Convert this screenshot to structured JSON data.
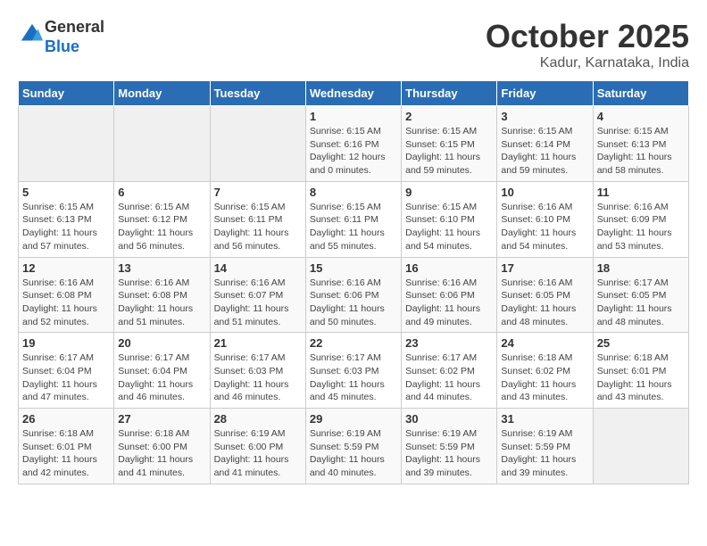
{
  "header": {
    "logo_line1": "General",
    "logo_line2": "Blue",
    "month": "October 2025",
    "location": "Kadur, Karnataka, India"
  },
  "weekdays": [
    "Sunday",
    "Monday",
    "Tuesday",
    "Wednesday",
    "Thursday",
    "Friday",
    "Saturday"
  ],
  "weeks": [
    [
      {
        "day": "",
        "info": ""
      },
      {
        "day": "",
        "info": ""
      },
      {
        "day": "",
        "info": ""
      },
      {
        "day": "1",
        "info": "Sunrise: 6:15 AM\nSunset: 6:16 PM\nDaylight: 12 hours and 0 minutes."
      },
      {
        "day": "2",
        "info": "Sunrise: 6:15 AM\nSunset: 6:15 PM\nDaylight: 11 hours and 59 minutes."
      },
      {
        "day": "3",
        "info": "Sunrise: 6:15 AM\nSunset: 6:14 PM\nDaylight: 11 hours and 59 minutes."
      },
      {
        "day": "4",
        "info": "Sunrise: 6:15 AM\nSunset: 6:13 PM\nDaylight: 11 hours and 58 minutes."
      }
    ],
    [
      {
        "day": "5",
        "info": "Sunrise: 6:15 AM\nSunset: 6:13 PM\nDaylight: 11 hours and 57 minutes."
      },
      {
        "day": "6",
        "info": "Sunrise: 6:15 AM\nSunset: 6:12 PM\nDaylight: 11 hours and 56 minutes."
      },
      {
        "day": "7",
        "info": "Sunrise: 6:15 AM\nSunset: 6:11 PM\nDaylight: 11 hours and 56 minutes."
      },
      {
        "day": "8",
        "info": "Sunrise: 6:15 AM\nSunset: 6:11 PM\nDaylight: 11 hours and 55 minutes."
      },
      {
        "day": "9",
        "info": "Sunrise: 6:15 AM\nSunset: 6:10 PM\nDaylight: 11 hours and 54 minutes."
      },
      {
        "day": "10",
        "info": "Sunrise: 6:16 AM\nSunset: 6:10 PM\nDaylight: 11 hours and 54 minutes."
      },
      {
        "day": "11",
        "info": "Sunrise: 6:16 AM\nSunset: 6:09 PM\nDaylight: 11 hours and 53 minutes."
      }
    ],
    [
      {
        "day": "12",
        "info": "Sunrise: 6:16 AM\nSunset: 6:08 PM\nDaylight: 11 hours and 52 minutes."
      },
      {
        "day": "13",
        "info": "Sunrise: 6:16 AM\nSunset: 6:08 PM\nDaylight: 11 hours and 51 minutes."
      },
      {
        "day": "14",
        "info": "Sunrise: 6:16 AM\nSunset: 6:07 PM\nDaylight: 11 hours and 51 minutes."
      },
      {
        "day": "15",
        "info": "Sunrise: 6:16 AM\nSunset: 6:06 PM\nDaylight: 11 hours and 50 minutes."
      },
      {
        "day": "16",
        "info": "Sunrise: 6:16 AM\nSunset: 6:06 PM\nDaylight: 11 hours and 49 minutes."
      },
      {
        "day": "17",
        "info": "Sunrise: 6:16 AM\nSunset: 6:05 PM\nDaylight: 11 hours and 48 minutes."
      },
      {
        "day": "18",
        "info": "Sunrise: 6:17 AM\nSunset: 6:05 PM\nDaylight: 11 hours and 48 minutes."
      }
    ],
    [
      {
        "day": "19",
        "info": "Sunrise: 6:17 AM\nSunset: 6:04 PM\nDaylight: 11 hours and 47 minutes."
      },
      {
        "day": "20",
        "info": "Sunrise: 6:17 AM\nSunset: 6:04 PM\nDaylight: 11 hours and 46 minutes."
      },
      {
        "day": "21",
        "info": "Sunrise: 6:17 AM\nSunset: 6:03 PM\nDaylight: 11 hours and 46 minutes."
      },
      {
        "day": "22",
        "info": "Sunrise: 6:17 AM\nSunset: 6:03 PM\nDaylight: 11 hours and 45 minutes."
      },
      {
        "day": "23",
        "info": "Sunrise: 6:17 AM\nSunset: 6:02 PM\nDaylight: 11 hours and 44 minutes."
      },
      {
        "day": "24",
        "info": "Sunrise: 6:18 AM\nSunset: 6:02 PM\nDaylight: 11 hours and 43 minutes."
      },
      {
        "day": "25",
        "info": "Sunrise: 6:18 AM\nSunset: 6:01 PM\nDaylight: 11 hours and 43 minutes."
      }
    ],
    [
      {
        "day": "26",
        "info": "Sunrise: 6:18 AM\nSunset: 6:01 PM\nDaylight: 11 hours and 42 minutes."
      },
      {
        "day": "27",
        "info": "Sunrise: 6:18 AM\nSunset: 6:00 PM\nDaylight: 11 hours and 41 minutes."
      },
      {
        "day": "28",
        "info": "Sunrise: 6:19 AM\nSunset: 6:00 PM\nDaylight: 11 hours and 41 minutes."
      },
      {
        "day": "29",
        "info": "Sunrise: 6:19 AM\nSunset: 5:59 PM\nDaylight: 11 hours and 40 minutes."
      },
      {
        "day": "30",
        "info": "Sunrise: 6:19 AM\nSunset: 5:59 PM\nDaylight: 11 hours and 39 minutes."
      },
      {
        "day": "31",
        "info": "Sunrise: 6:19 AM\nSunset: 5:59 PM\nDaylight: 11 hours and 39 minutes."
      },
      {
        "day": "",
        "info": ""
      }
    ]
  ]
}
